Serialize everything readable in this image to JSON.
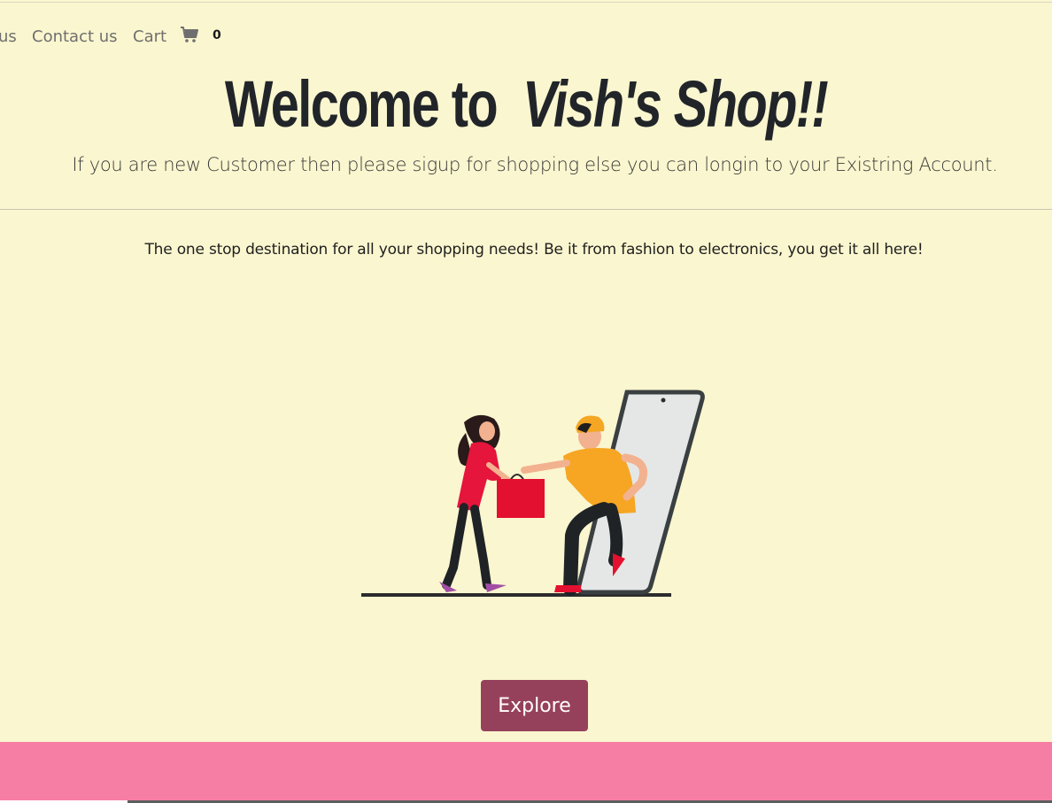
{
  "nav": {
    "about_label": "us",
    "contact_label": "Contact us",
    "cart_label": "Cart",
    "cart_icon": "cart-icon",
    "cart_count": "0"
  },
  "hero": {
    "title_prefix": "Welcome to",
    "title_brand": "Vish's Shop!!",
    "lead": "If you are new Customer then please sigup for shopping else you can longin to your Existring Account."
  },
  "main": {
    "tagline": "The one stop destination for all your shopping needs! Be it from fashion to electronics, you get it all here!",
    "illustration": "shopping-delivery-illustration",
    "explore_label": "Explore"
  },
  "colors": {
    "background": "#faf6cf",
    "button": "#96415c",
    "footer": "#f67ea5"
  }
}
